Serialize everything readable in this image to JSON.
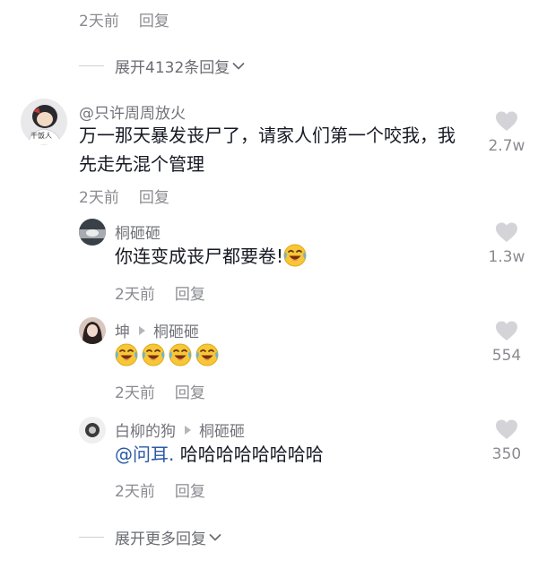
{
  "top_meta": {
    "time": "2天前",
    "reply": "回复"
  },
  "expand_replies_top": {
    "label": "展开4132条回复"
  },
  "comment": {
    "username": "@只许周周放火",
    "avatar_caption": "干饭人",
    "text": "万一那天暴发丧尸了，请家人们第一个咬我，我先走先混个管理",
    "time": "2天前",
    "reply": "回复",
    "likes": "2.7w"
  },
  "replies": [
    {
      "username": "桐砸砸",
      "text": "你连变成丧尸都要卷!",
      "emoji_count": 1,
      "time": "2天前",
      "reply": "回复",
      "likes": "1.3w"
    },
    {
      "username": "坤",
      "reply_to": "桐砸砸",
      "emoji_count": 4,
      "time": "2天前",
      "reply": "回复",
      "likes": "554"
    },
    {
      "username": "白柳的狗",
      "reply_to": "桐砸砸",
      "mention": "@问耳.",
      "text": " 哈哈哈哈哈哈哈哈",
      "time": "2天前",
      "reply": "回复",
      "likes": "350"
    }
  ],
  "expand_more": {
    "label": "展开更多回复"
  },
  "icons": {
    "like": "heart-icon",
    "expand": "chevron-down-icon",
    "reply_arrow": "triangle-right-icon",
    "emoji": "crying-laughing-emoji-icon"
  },
  "colors": {
    "text": "#161823",
    "meta": "#8a8b91",
    "mention": "#2b5aa8",
    "heart": "#d4d4d8"
  }
}
